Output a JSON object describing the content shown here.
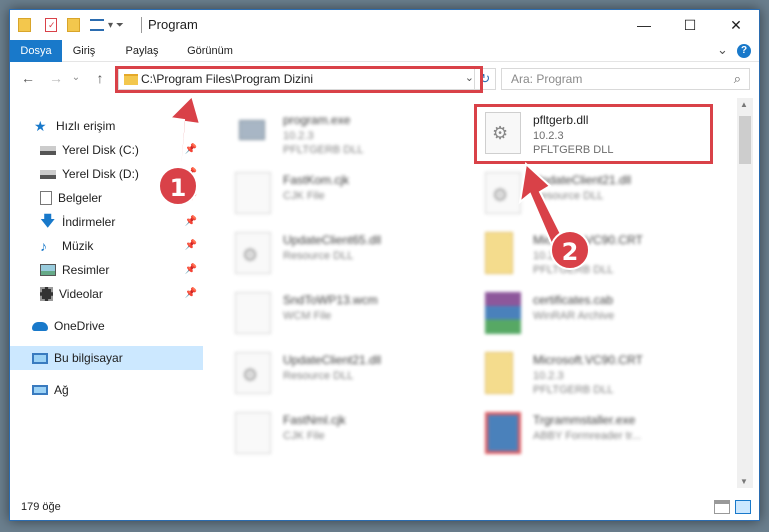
{
  "window": {
    "title": "Program",
    "controls": {
      "minimize": "—",
      "maximize": "☐",
      "close": "✕"
    }
  },
  "ribbon": {
    "tabs": [
      "Dosya",
      "Giriş",
      "Paylaş",
      "Görünüm"
    ],
    "active_tab": "Dosya",
    "expand": "⌄",
    "help": "?"
  },
  "navigation": {
    "back": "←",
    "forward": "→",
    "recent": "⌄",
    "up": "↑",
    "address": "C:\\Program Files\\Program Dizini",
    "search_placeholder": "Ara: Program"
  },
  "sidebar": {
    "items": [
      {
        "label": "Hızlı erişim",
        "icon": "star-icon",
        "pinned": false
      },
      {
        "label": "Yerel Disk (C:)",
        "icon": "drive-icon",
        "pinned": true
      },
      {
        "label": "Yerel Disk (D:)",
        "icon": "drive-icon",
        "pinned": true
      },
      {
        "label": "Belgeler",
        "icon": "documents-icon",
        "pinned": true
      },
      {
        "label": "İndirmeler",
        "icon": "download-icon",
        "pinned": true
      },
      {
        "label": "Müzik",
        "icon": "music-icon",
        "pinned": true
      },
      {
        "label": "Resimler",
        "icon": "pictures-icon",
        "pinned": true
      },
      {
        "label": "Videolar",
        "icon": "video-icon",
        "pinned": true
      },
      {
        "label": "OneDrive",
        "icon": "cloud-icon",
        "pinned": false
      },
      {
        "label": "Bu bilgisayar",
        "icon": "computer-icon",
        "pinned": false,
        "selected": true
      },
      {
        "label": "Ağ",
        "icon": "network-icon",
        "pinned": false
      }
    ]
  },
  "files": {
    "left": [
      {
        "name": "program.exe",
        "l2": "10.2.3",
        "l3": "PFLTGERB DLL",
        "icon": "exe-icon"
      },
      {
        "name": "FastKom.cjk",
        "l2": "CJK File",
        "l3": "",
        "icon": "file-icon"
      },
      {
        "name": "UpdateClient65.dll",
        "l2": "Resource DLL",
        "l3": "",
        "icon": "dll-icon"
      },
      {
        "name": "SndToWP13.wcm",
        "l2": "WCM File",
        "l3": "",
        "icon": "file-icon"
      },
      {
        "name": "UpdateClient21.dll",
        "l2": "Resource DLL",
        "l3": "",
        "icon": "dll-icon"
      },
      {
        "name": "FastNml.cjk",
        "l2": "CJK File",
        "l3": "",
        "icon": "file-icon"
      }
    ],
    "right": [
      {
        "name": "pfltgerb.dll",
        "l2": "10.2.3",
        "l3": "PFLTGERB DLL",
        "icon": "dll-icon"
      },
      {
        "name": "UpdateClient21.dll",
        "l2": "Resource DLL",
        "l3": "",
        "icon": "dll-icon"
      },
      {
        "name": "Microsoft.VC90.CRT",
        "l2": "10.2.3",
        "l3": "PFLTGERB DLL",
        "icon": "folder-icon"
      },
      {
        "name": "certificates.cab",
        "l2": "WinRAR Archive",
        "l3": "",
        "icon": "archive-icon"
      },
      {
        "name": "Microsoft.VC90.CRT",
        "l2": "10.2.3",
        "l3": "PFLTGERB DLL",
        "icon": "folder-icon"
      },
      {
        "name": "Trgrammstaller.exe",
        "l2": "ABBY Formreader tr...",
        "l3": "",
        "icon": "installer-icon"
      }
    ]
  },
  "status": {
    "count": "179 öğe"
  },
  "annotations": {
    "step1": "1",
    "step2": "2",
    "color": "#d94148"
  }
}
